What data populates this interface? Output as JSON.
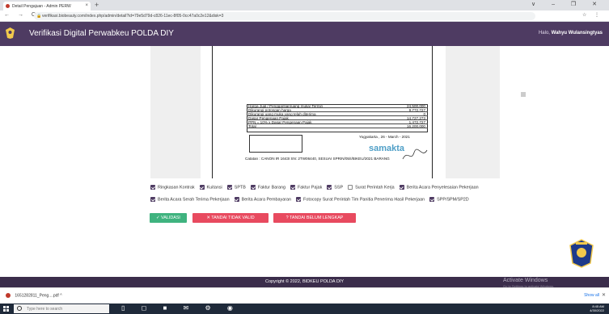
{
  "browser": {
    "tab_title": "Detail Pengajuan - Admin PERW",
    "tab_close": "×",
    "new_tab": "+",
    "url": "verifikasi.biobeauty.com/index.php/admin/detail?id=79e5d79d-c826-11ec-8f05-0cc47a0c2e12&disk=3",
    "window_controls": "∨ – ❐ ✕",
    "nav": "← → C"
  },
  "app": {
    "title": "Verifikasi Digital Perwabkeu POLDA DIY",
    "greeting_prefix": "Halo,",
    "user_name": "Wahyu Wulansingtyas"
  },
  "document": {
    "rows": [
      {
        "label": "Harga Jual / Penggantian/uang muka/ Termin",
        "value": "24,500,000"
      },
      {
        "label": "Dikurangi potongan harga",
        "value": "9,772,727"
      },
      {
        "label": "Dikurangi uang muka yang telah diterima",
        "value": "0"
      },
      {
        "label": "Dasar Pengenaan Pajak",
        "value": "14,727,273"
      },
      {
        "label": "PPN = 10% x Dasar Pengenaan Pajak",
        "value": "1,472,727"
      },
      {
        "label": "Total",
        "value": "16,200,000"
      }
    ],
    "signer_place_date": "Yogyakarta , 26 - March  - 2021",
    "stamp": "samakta",
    "catatan": "Catatan :    CANON IR 1643I SN: 2TW06440, SESUAI SPRIN/05/I/BIKEU/2021 BARANG"
  },
  "checks": [
    {
      "label": "Ringkasan Kontrak",
      "checked": true
    },
    {
      "label": "Kuitansi",
      "checked": true
    },
    {
      "label": "SPTB",
      "checked": true
    },
    {
      "label": "Faktur Barang",
      "checked": true
    },
    {
      "label": "Faktur Pajak",
      "checked": true
    },
    {
      "label": "SSP",
      "checked": true
    },
    {
      "label": "Surat Perintah Kerja",
      "checked": false
    },
    {
      "label": "Berita Acara Penyelesaian Pekerjaan",
      "checked": true
    },
    {
      "label": "Berita Acara Serah Terima Pekerjaan",
      "checked": true
    },
    {
      "label": "Berita Acara Pembayaran",
      "checked": true
    },
    {
      "label": "Fotocopy Surat Perintah Tim Panitia Penerima Hasil Pekerjaan",
      "checked": true
    },
    {
      "label": "SPP/SPM/SP2D",
      "checked": true
    }
  ],
  "buttons": {
    "validasi": "✓  VALIDASI",
    "tidak_valid": "✕  TANDAI TIDAK VALID",
    "belum_lengkap": "?  TANDAI BELUM LENGKAP"
  },
  "footer": {
    "copyright": "Copyright © 2022, BIDKEU POLDA DIY",
    "activate_title": "Activate Windows",
    "activate_sub": "Go to Settings to activate Windows."
  },
  "downloads": {
    "file": "1651282811_Peng....pdf",
    "caret": "^",
    "show_all": "Show all",
    "close": "✕"
  },
  "taskbar": {
    "search_placeholder": "Type here to search",
    "time": "8:45 AM",
    "date": "4/30/2022"
  },
  "colors": {
    "header": "#4e3b62",
    "footer": "#3b2d4b",
    "validasi": "#3fb37f",
    "danger": "#e84a5f"
  }
}
